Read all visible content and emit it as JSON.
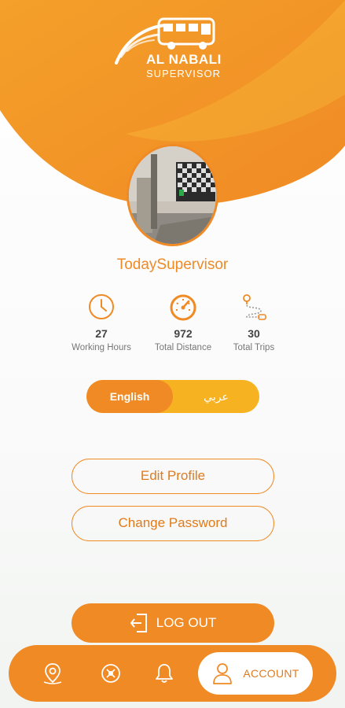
{
  "brand": {
    "title": "AL NABALI",
    "subtitle": "SUPERVISOR",
    "primary_color": "#f08a24",
    "secondary_color": "#f6b221"
  },
  "profile": {
    "username": "TodaySupervisor"
  },
  "stats": [
    {
      "icon": "clock-icon",
      "value": "27",
      "label": "Working Hours"
    },
    {
      "icon": "speedometer-icon",
      "value": "972",
      "label": "Total Distance"
    },
    {
      "icon": "route-icon",
      "value": "30",
      "label": "Total Trips"
    }
  ],
  "language": {
    "english": "English",
    "arabic": "عربي",
    "selected": "English"
  },
  "actions": {
    "edit_profile": "Edit Profile",
    "change_password": "Change Password",
    "logout": "LOG OUT"
  },
  "nav": {
    "items": [
      {
        "icon": "map-pin-icon"
      },
      {
        "icon": "bus-stop-icon"
      },
      {
        "icon": "bell-icon"
      },
      {
        "icon": "user-icon",
        "label": "ACCOUNT",
        "active": true
      }
    ]
  }
}
